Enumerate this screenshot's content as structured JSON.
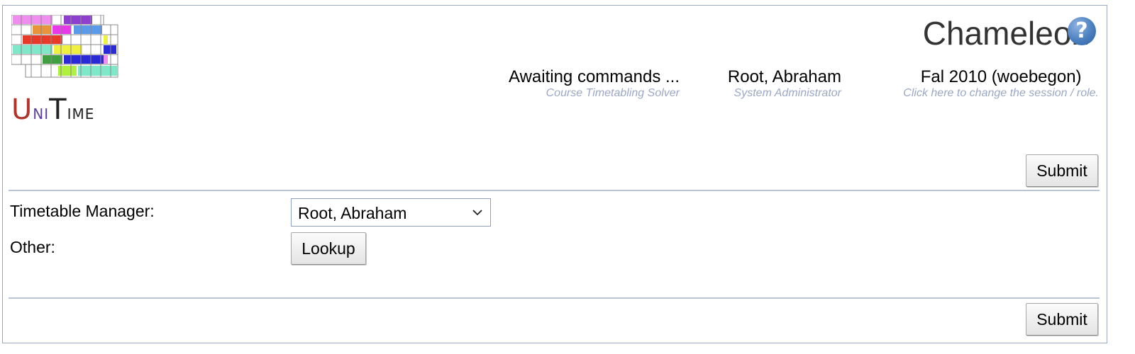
{
  "header": {
    "logo": {
      "text_u": "U",
      "text_n": "ni",
      "text_t": "T",
      "text_ime": "ime"
    },
    "app_title": "Chameleon",
    "help_icon": "help-question-icon",
    "solver_status": {
      "main": "Awaiting commands ...",
      "sub": "Course Timetabling Solver"
    },
    "user": {
      "main": "Root, Abraham",
      "sub": "System Administrator"
    },
    "session": {
      "main": "Fal 2010 (woebegon)",
      "sub": "Click here to change the session / role."
    }
  },
  "form": {
    "submit_label": "Submit",
    "timetable_manager_label": "Timetable Manager:",
    "timetable_manager_value": "Root, Abraham",
    "other_label": "Other:",
    "lookup_label": "Lookup"
  },
  "colors": {
    "border": "#9aa8c4",
    "subtext": "#9aa8c4",
    "help_blue": "#4a7fc0"
  }
}
